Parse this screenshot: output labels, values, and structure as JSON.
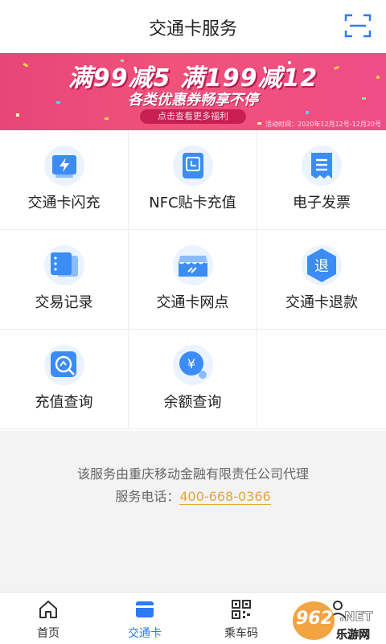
{
  "header": {
    "title": "交通卡服务",
    "scan_icon": "scan-icon"
  },
  "banner": {
    "promo": "满99减5 满199减12",
    "sub": "各类优惠券畅享不停",
    "cta": "点击查看更多福利",
    "date": "活动时间：2020年12月12号-12月20号"
  },
  "services": [
    {
      "label": "交通卡闪充",
      "icon": "flash-charge-icon"
    },
    {
      "label": "NFC贴卡充值",
      "icon": "nfc-icon"
    },
    {
      "label": "电子发票",
      "icon": "invoice-icon"
    },
    {
      "label": "交易记录",
      "icon": "records-icon"
    },
    {
      "label": "交通卡网点",
      "icon": "store-icon"
    },
    {
      "label": "交通卡退款",
      "icon": "refund-icon",
      "glyph": "退"
    },
    {
      "label": "充值查询",
      "icon": "recharge-query-icon"
    },
    {
      "label": "余额查询",
      "icon": "balance-query-icon",
      "glyph": "¥"
    }
  ],
  "footer": {
    "provider": "该服务由重庆移动金融有限责任公司代理",
    "phone_label": "服务电话：",
    "phone": "400-668-0366"
  },
  "tabs": [
    {
      "label": "首页",
      "icon": "home-icon"
    },
    {
      "label": "交通卡",
      "icon": "card-icon"
    },
    {
      "label": "乘车码",
      "icon": "qr-code-icon"
    },
    {
      "label": "",
      "icon": "user-icon"
    }
  ],
  "colors": {
    "accent": "#2c7af6",
    "phone": "#e0a73a",
    "banner": "#ee4d80"
  },
  "watermark": {
    "text": "962.NET",
    "sub": "乐游网"
  }
}
